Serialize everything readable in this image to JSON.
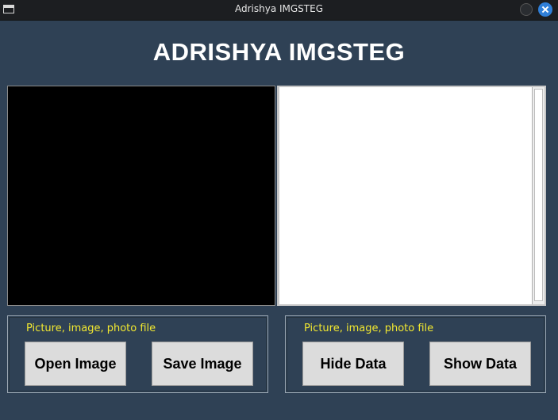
{
  "window": {
    "title": "Adrishya IMGSTEG",
    "controls": [
      "minimize-icon",
      "close-icon"
    ]
  },
  "header": {
    "title": "ADRISHYA IMGSTEG"
  },
  "left_group": {
    "label": "Picture, image, photo file",
    "buttons": [
      "Open Image",
      "Save Image"
    ]
  },
  "right_group": {
    "label": "Picture, image, photo file",
    "buttons": [
      "Hide Data",
      "Show Data"
    ]
  },
  "colors": {
    "background": "#2f4155",
    "label": "#f2e830",
    "button": "#dcdcdc",
    "close_button": "#2f7fd8"
  }
}
